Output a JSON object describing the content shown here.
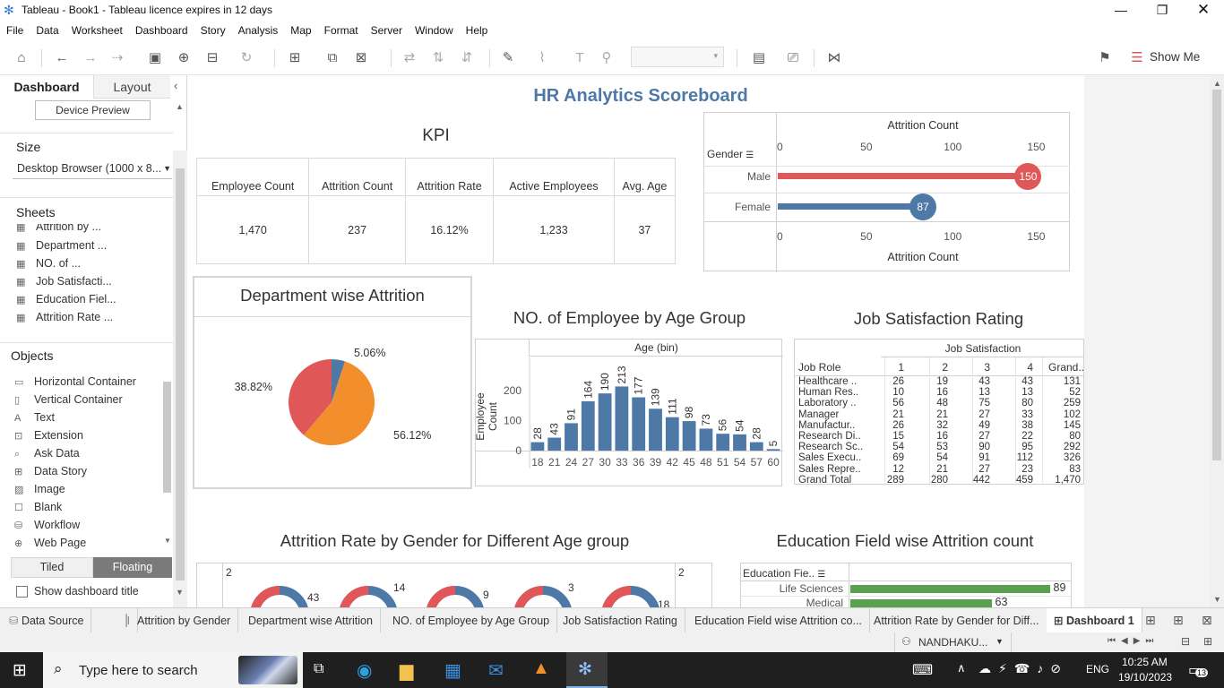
{
  "window": {
    "title": "Tableau - Book1 - Tableau licence expires in 12 days"
  },
  "menu": [
    "File",
    "Data",
    "Worksheet",
    "Dashboard",
    "Story",
    "Analysis",
    "Map",
    "Format",
    "Server",
    "Window",
    "Help"
  ],
  "toolbar": {
    "show_me": "Show Me"
  },
  "left_panel": {
    "tab_dashboard": "Dashboard",
    "tab_layout": "Layout",
    "device_preview": "Device Preview",
    "size_heading": "Size",
    "size_value": "Desktop Browser (1000 x 8...",
    "sheets_heading": "Sheets",
    "sheets": [
      "Attrition by ...",
      "Department ...",
      "NO. of ...",
      "Job Satisfacti...",
      "Education Fiel...",
      "Attrition Rate ..."
    ],
    "objects_heading": "Objects",
    "objects": [
      {
        "icon": "horizontal-container-icon",
        "label": "Horizontal Container"
      },
      {
        "icon": "vertical-container-icon",
        "label": "Vertical Container"
      },
      {
        "icon": "text-icon",
        "label": "Text"
      },
      {
        "icon": "extension-icon",
        "label": "Extension"
      },
      {
        "icon": "ask-data-icon",
        "label": "Ask Data"
      },
      {
        "icon": "data-story-icon",
        "label": "Data Story"
      },
      {
        "icon": "image-icon",
        "label": "Image"
      },
      {
        "icon": "blank-icon",
        "label": "Blank"
      },
      {
        "icon": "workflow-icon",
        "label": "Workflow"
      },
      {
        "icon": "web-page-icon",
        "label": "Web Page"
      }
    ],
    "tiled": "Tiled",
    "floating": "Floating",
    "show_title": "Show dashboard title"
  },
  "dashboard": {
    "title": "HR Analytics Scoreboard",
    "kpi": {
      "title": "KPI",
      "headers": [
        "Employee Count",
        "Attrition Count",
        "Attrition Rate",
        "Active Employees",
        "Avg. Age"
      ],
      "values": [
        "1,470",
        "237",
        "16.12%",
        "1,233",
        "37"
      ]
    },
    "attrition_gender": {
      "axis_title": "Attrition Count",
      "row_header": "Gender",
      "ticks": [
        "0",
        "50",
        "100",
        "150"
      ],
      "rows": [
        {
          "label": "Male",
          "value": 150,
          "display": "150",
          "color": "#e05759"
        },
        {
          "label": "Female",
          "value": 87,
          "display": "87",
          "color": "#4e79a7"
        }
      ],
      "axis_max": 175
    },
    "department": {
      "title": "Department wise Attrition",
      "slices": [
        {
          "value": 5.06,
          "label": "5.06%",
          "color": "#4e79a7"
        },
        {
          "value": 56.12,
          "label": "56.12%",
          "color": "#f28e2b"
        },
        {
          "value": 38.82,
          "label": "38.82%",
          "color": "#e15759"
        }
      ]
    },
    "age_group": {
      "title": "NO. of Employee by Age Group",
      "axis_header": "Age (bin)",
      "ylabel": "Employee Count",
      "yticks": [
        "0",
        "100",
        "200"
      ],
      "categories": [
        "18",
        "21",
        "24",
        "27",
        "30",
        "33",
        "36",
        "39",
        "42",
        "45",
        "48",
        "51",
        "54",
        "57",
        "60"
      ],
      "values": [
        28,
        43,
        91,
        164,
        190,
        213,
        177,
        139,
        111,
        98,
        73,
        56,
        54,
        28,
        5
      ],
      "color": "#4e79a7",
      "ymax": 250
    },
    "job_satisfaction": {
      "title": "Job Satisfaction Rating",
      "column_header": "Job Satisfaction",
      "row_header": "Job Role",
      "columns": [
        "1",
        "2",
        "3",
        "4",
        "Grand.."
      ],
      "rows": [
        [
          "Healthcare ..",
          "26",
          "19",
          "43",
          "43",
          "131"
        ],
        [
          "Human Res..",
          "10",
          "16",
          "13",
          "13",
          "52"
        ],
        [
          "Laboratory ..",
          "56",
          "48",
          "75",
          "80",
          "259"
        ],
        [
          "Manager",
          "21",
          "21",
          "27",
          "33",
          "102"
        ],
        [
          "Manufactur..",
          "26",
          "32",
          "49",
          "38",
          "145"
        ],
        [
          "Research Di..",
          "15",
          "16",
          "27",
          "22",
          "80"
        ],
        [
          "Research Sc..",
          "54",
          "53",
          "90",
          "95",
          "292"
        ],
        [
          "Sales Execu..",
          "69",
          "54",
          "91",
          "112",
          "326"
        ],
        [
          "Sales Repre..",
          "12",
          "21",
          "27",
          "23",
          "83"
        ],
        [
          "Grand Total",
          "289",
          "280",
          "442",
          "459",
          "1,470"
        ]
      ]
    },
    "rate_by_gender": {
      "title": "Attrition Rate by Gender for Different Age group",
      "left_tick": "2",
      "right_tick": "2",
      "donut_labels": [
        "43",
        "14",
        "9",
        "3",
        "18"
      ]
    },
    "education": {
      "title": "Education Field wise Attrition count",
      "row_header": "Education Fie..",
      "rows": [
        {
          "label": "Life Sciences",
          "value": 89
        },
        {
          "label": "Medical",
          "value": 63
        }
      ],
      "color": "#59a14f",
      "axis_max": 100
    }
  },
  "tabs": {
    "data_source": "Data Source",
    "sheets": [
      "Attrition by Gender",
      "Department wise Attrition",
      "NO. of Employee by Age Group",
      "Job Satisfaction Rating",
      "Education Field wise Attrition co...",
      "Attrition Rate by Gender for Diff..."
    ],
    "active": "Dashboard 1"
  },
  "status": {
    "user": "NANDHAKU..."
  },
  "taskbar": {
    "search_placeholder": "Type here to search",
    "time": "10:25 AM",
    "date": "19/10/2023",
    "lang": "ENG",
    "notifications": "13"
  }
}
